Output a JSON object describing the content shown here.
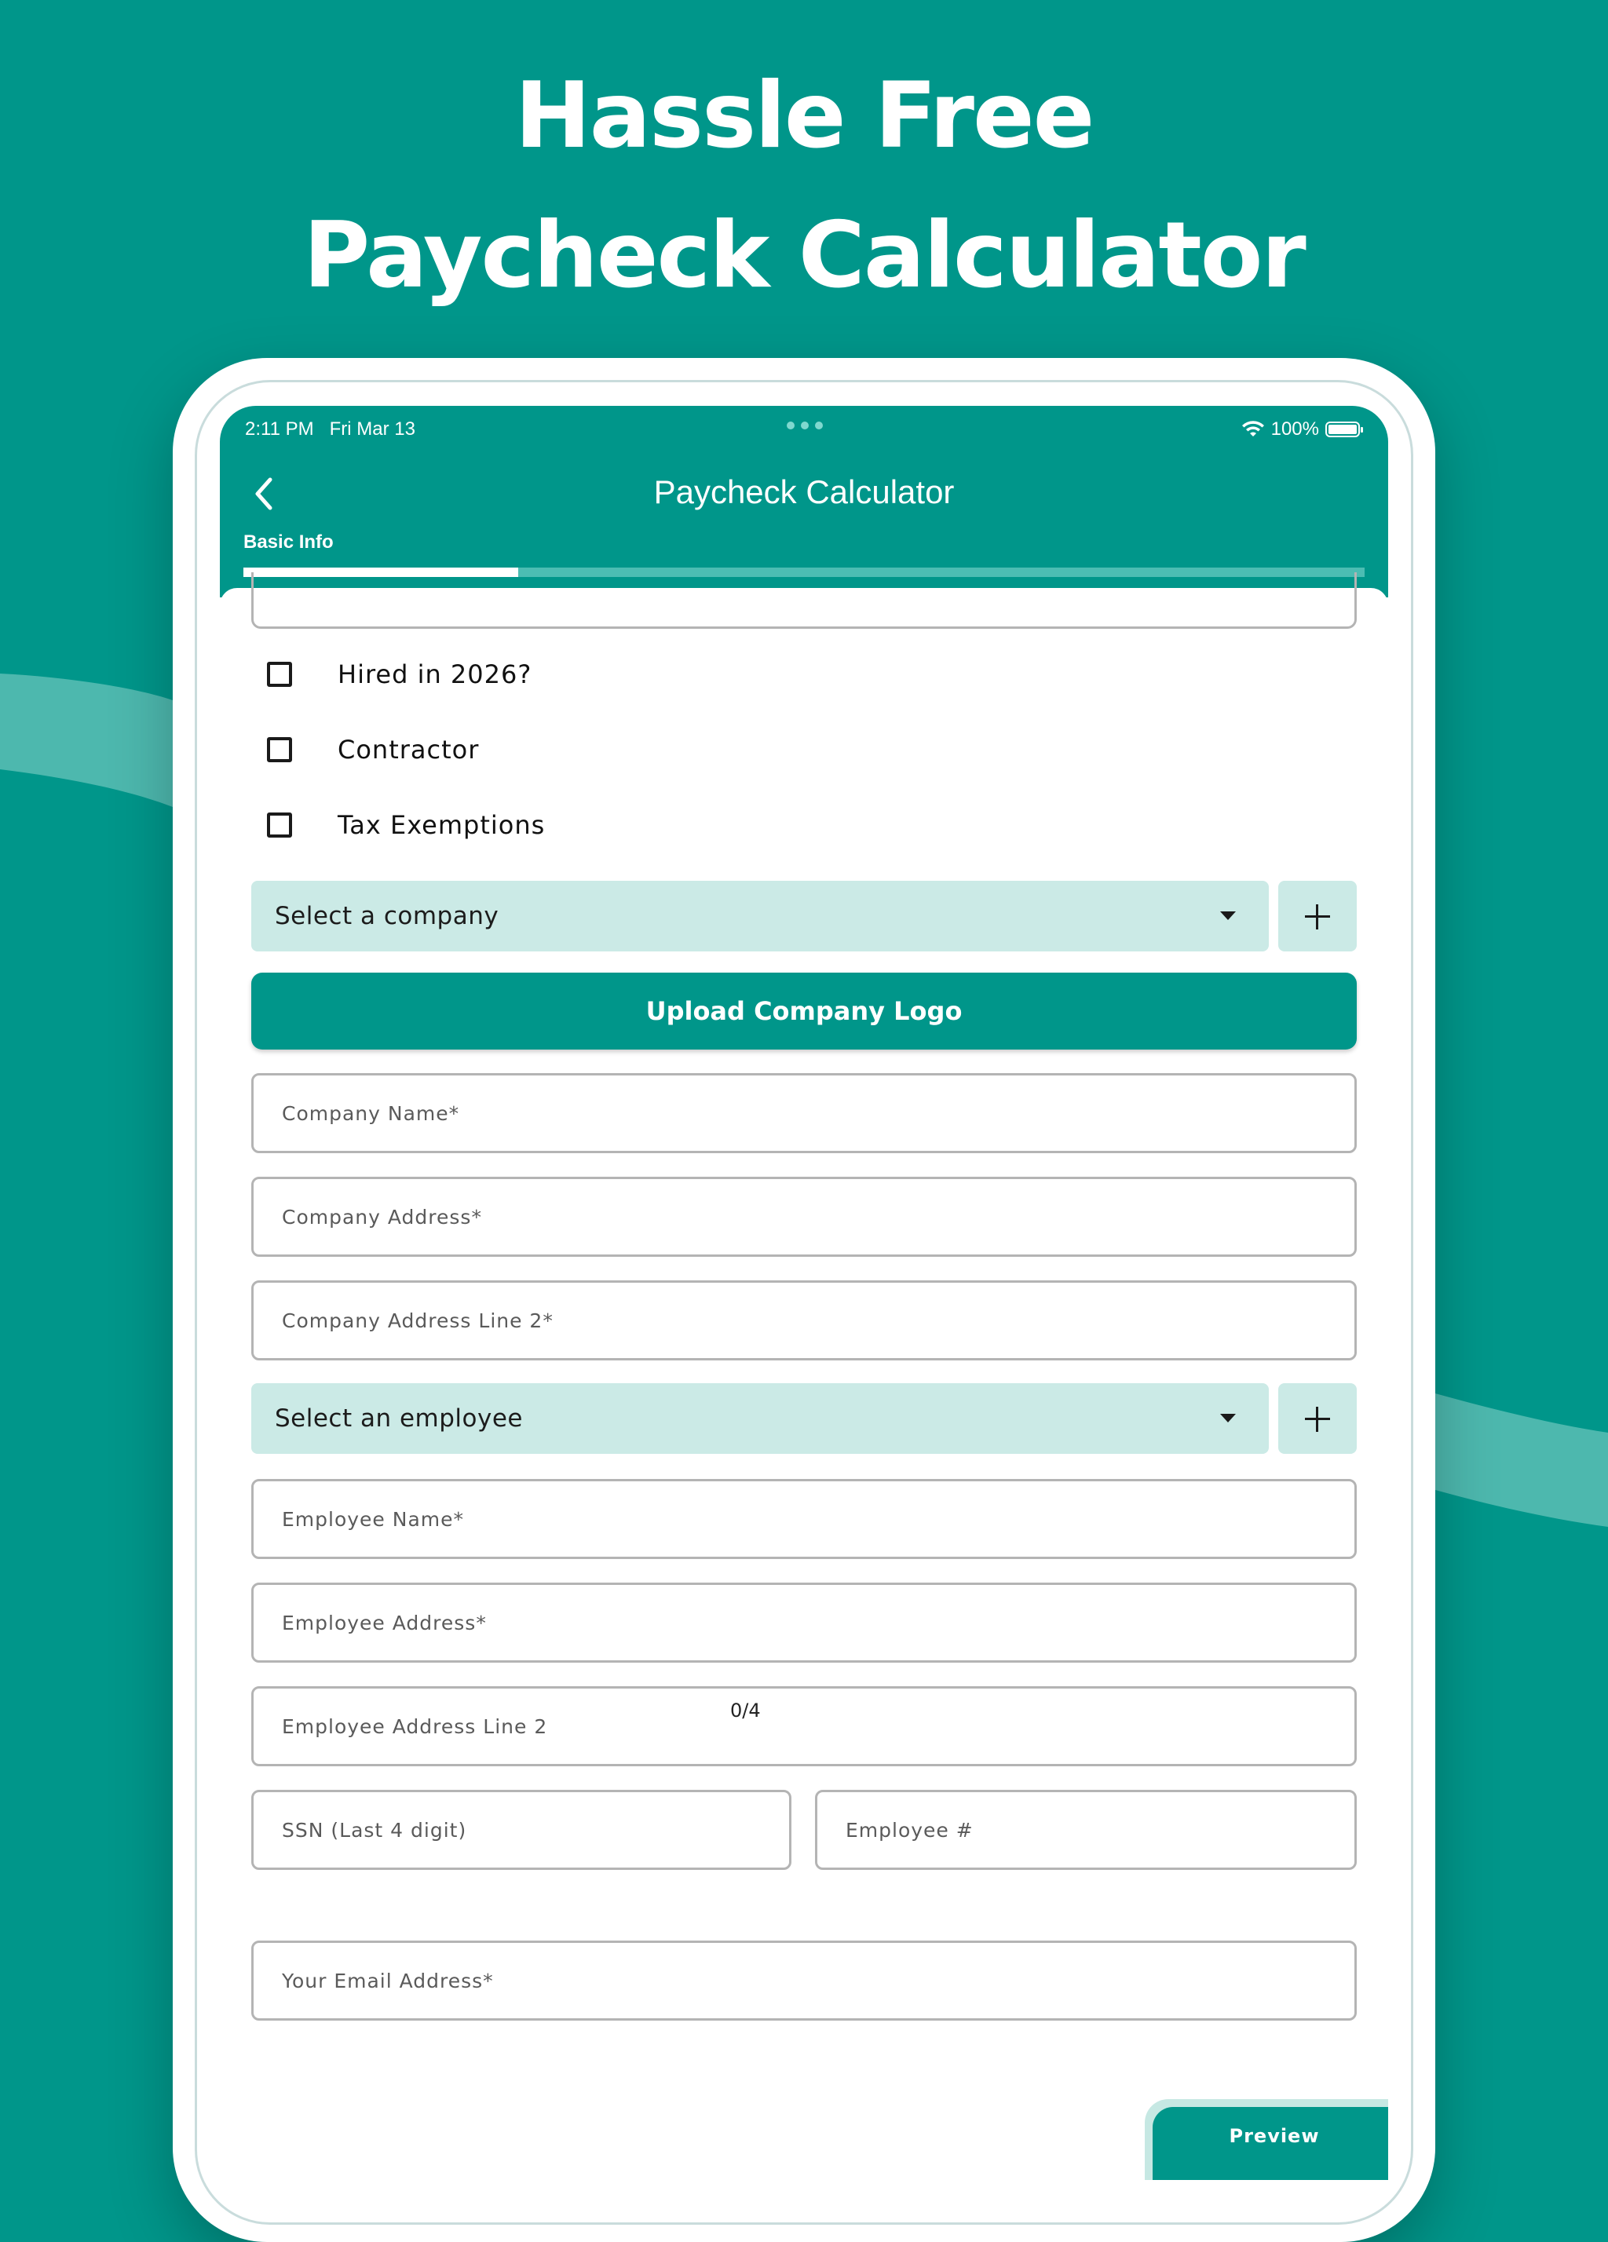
{
  "promo": {
    "headline_line1": "Hassle Free",
    "headline_line2": "Paycheck Calculator"
  },
  "status_bar": {
    "time": "2:11 PM",
    "date": "Fri Mar 13",
    "battery_percent": "100%"
  },
  "app_bar": {
    "title": "Paycheck Calculator",
    "step_label": "Basic Info",
    "progress_fraction": 0.245
  },
  "checkboxes": [
    {
      "label": "Hired in 2026?",
      "checked": false
    },
    {
      "label": "Contractor",
      "checked": false
    },
    {
      "label": "Tax Exemptions",
      "checked": false
    }
  ],
  "company_select": {
    "value": "Select a company"
  },
  "upload_logo_label": "Upload Company Logo",
  "company_fields": {
    "name": "Company Name*",
    "address": "Company Address*",
    "address_line2": "Company Address Line 2*"
  },
  "employee_select": {
    "value": "Select an employee"
  },
  "employee_fields": {
    "name": "Employee Name*",
    "address": "Employee Address*",
    "address_line2": "Employee Address Line 2",
    "ssn": "SSN (Last 4 digit)",
    "ssn_counter": "0/4",
    "employee_number": "Employee #",
    "email": "Your Email Address*"
  },
  "preview_label": "Preview",
  "colors": {
    "brand": "#00968a",
    "select_fill": "#cbeae6",
    "progress_track": "#4cbdb3"
  }
}
